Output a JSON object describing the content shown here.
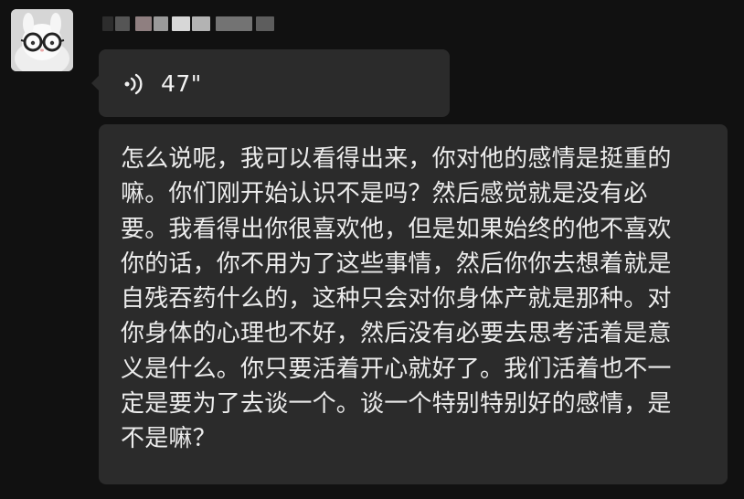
{
  "chat": {
    "sender": {
      "avatar_icon": "bunny-with-glasses-avatar-icon",
      "name_redacted": true,
      "name_colors": [
        "#2d2d2d",
        "#8f7f80",
        "#9a9a9a",
        "#d7d7d7",
        "#b3b3b3",
        "#737373"
      ]
    },
    "voice_message": {
      "icon": "voice-wave-icon",
      "duration": "47\""
    },
    "transcription": {
      "text": "怎么说呢，我可以看得出来，你对他的感情是挺重的\n嘛。你们刚开始认识不是吗？然后感觉就是没有必\n要。我看得出你很喜欢他，但是如果始终的他不喜欢\n你的话，你不用为了这些事情，然后你你去想着就是\n自残吞药什么的，这种只会对你身体产就是那种。对\n你身体的心理也不好，然后没有必要去思考活着是意\n义是什么。你只要活着开心就好了。我们活着也不一\n定是要为了去谈一个。谈一个特别特别好的感情，是\n不是嘛？"
    }
  },
  "colors": {
    "background": "#111111",
    "bubble": "#2b2b2b",
    "text": "#ececec"
  }
}
